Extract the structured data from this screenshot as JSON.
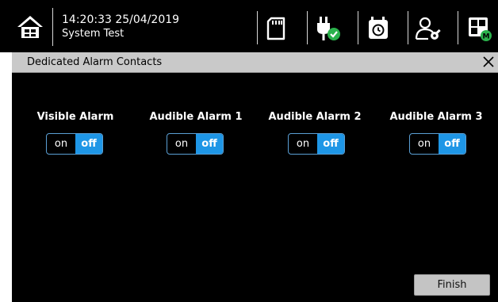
{
  "topbar": {
    "time": "14:20:33",
    "date": "25/04/2019",
    "subtitle": "System Test",
    "icons": [
      "home-icon",
      "sd-card-icon",
      "power-plug-check-icon",
      "calendar-clock-icon",
      "user-wrench-icon",
      "layout-mode-icon"
    ]
  },
  "dialog": {
    "title": "Dedicated Alarm Contacts",
    "alarms": [
      {
        "label": "Visible Alarm",
        "on_label": "on",
        "off_label": "off",
        "state": "off"
      },
      {
        "label": "Audible Alarm 1",
        "on_label": "on",
        "off_label": "off",
        "state": "off"
      },
      {
        "label": "Audible Alarm 2",
        "on_label": "on",
        "off_label": "off",
        "state": "off"
      },
      {
        "label": "Audible Alarm 3",
        "on_label": "on",
        "off_label": "off",
        "state": "off"
      }
    ],
    "finish_label": "Finish"
  },
  "colors": {
    "background": "#000000",
    "titlebar": "#c9c9c9",
    "toggle_active": "#1e96e6",
    "status_green": "#2bb24c",
    "button": "#c4c4c4"
  }
}
